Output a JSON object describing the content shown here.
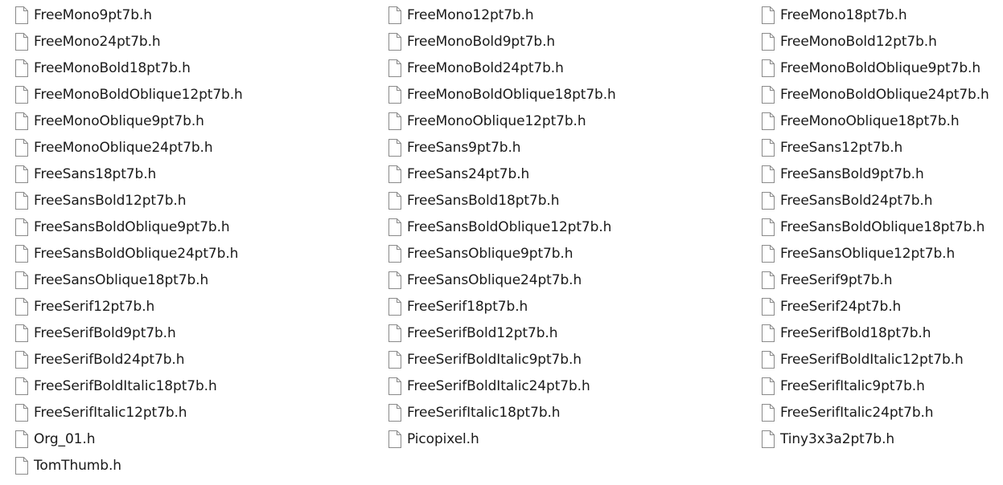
{
  "files": [
    "FreeMono9pt7b.h",
    "FreeMono12pt7b.h",
    "FreeMono18pt7b.h",
    "FreeMono24pt7b.h",
    "FreeMonoBold9pt7b.h",
    "FreeMonoBold12pt7b.h",
    "FreeMonoBold18pt7b.h",
    "FreeMonoBold24pt7b.h",
    "FreeMonoBoldOblique9pt7b.h",
    "FreeMonoBoldOblique12pt7b.h",
    "FreeMonoBoldOblique18pt7b.h",
    "FreeMonoBoldOblique24pt7b.h",
    "FreeMonoOblique9pt7b.h",
    "FreeMonoOblique12pt7b.h",
    "FreeMonoOblique18pt7b.h",
    "FreeMonoOblique24pt7b.h",
    "FreeSans9pt7b.h",
    "FreeSans12pt7b.h",
    "FreeSans18pt7b.h",
    "FreeSans24pt7b.h",
    "FreeSansBold9pt7b.h",
    "FreeSansBold12pt7b.h",
    "FreeSansBold18pt7b.h",
    "FreeSansBold24pt7b.h",
    "FreeSansBoldOblique9pt7b.h",
    "FreeSansBoldOblique12pt7b.h",
    "FreeSansBoldOblique18pt7b.h",
    "FreeSansBoldOblique24pt7b.h",
    "FreeSansOblique9pt7b.h",
    "FreeSansOblique12pt7b.h",
    "FreeSansOblique18pt7b.h",
    "FreeSansOblique24pt7b.h",
    "FreeSerif9pt7b.h",
    "FreeSerif12pt7b.h",
    "FreeSerif18pt7b.h",
    "FreeSerif24pt7b.h",
    "FreeSerifBold9pt7b.h",
    "FreeSerifBold12pt7b.h",
    "FreeSerifBold18pt7b.h",
    "FreeSerifBold24pt7b.h",
    "FreeSerifBoldItalic9pt7b.h",
    "FreeSerifBoldItalic12pt7b.h",
    "FreeSerifBoldItalic18pt7b.h",
    "FreeSerifBoldItalic24pt7b.h",
    "FreeSerifItalic9pt7b.h",
    "FreeSerifItalic12pt7b.h",
    "FreeSerifItalic18pt7b.h",
    "FreeSerifItalic24pt7b.h",
    "Org_01.h",
    "Picopixel.h",
    "Tiny3x3a2pt7b.h",
    "TomThumb.h"
  ],
  "file_icon": "document-icon",
  "colors": {
    "background": "#ffffff",
    "text": "#1a1a1a",
    "icon_stroke": "#8a8a8a",
    "icon_fill": "#ffffff"
  }
}
